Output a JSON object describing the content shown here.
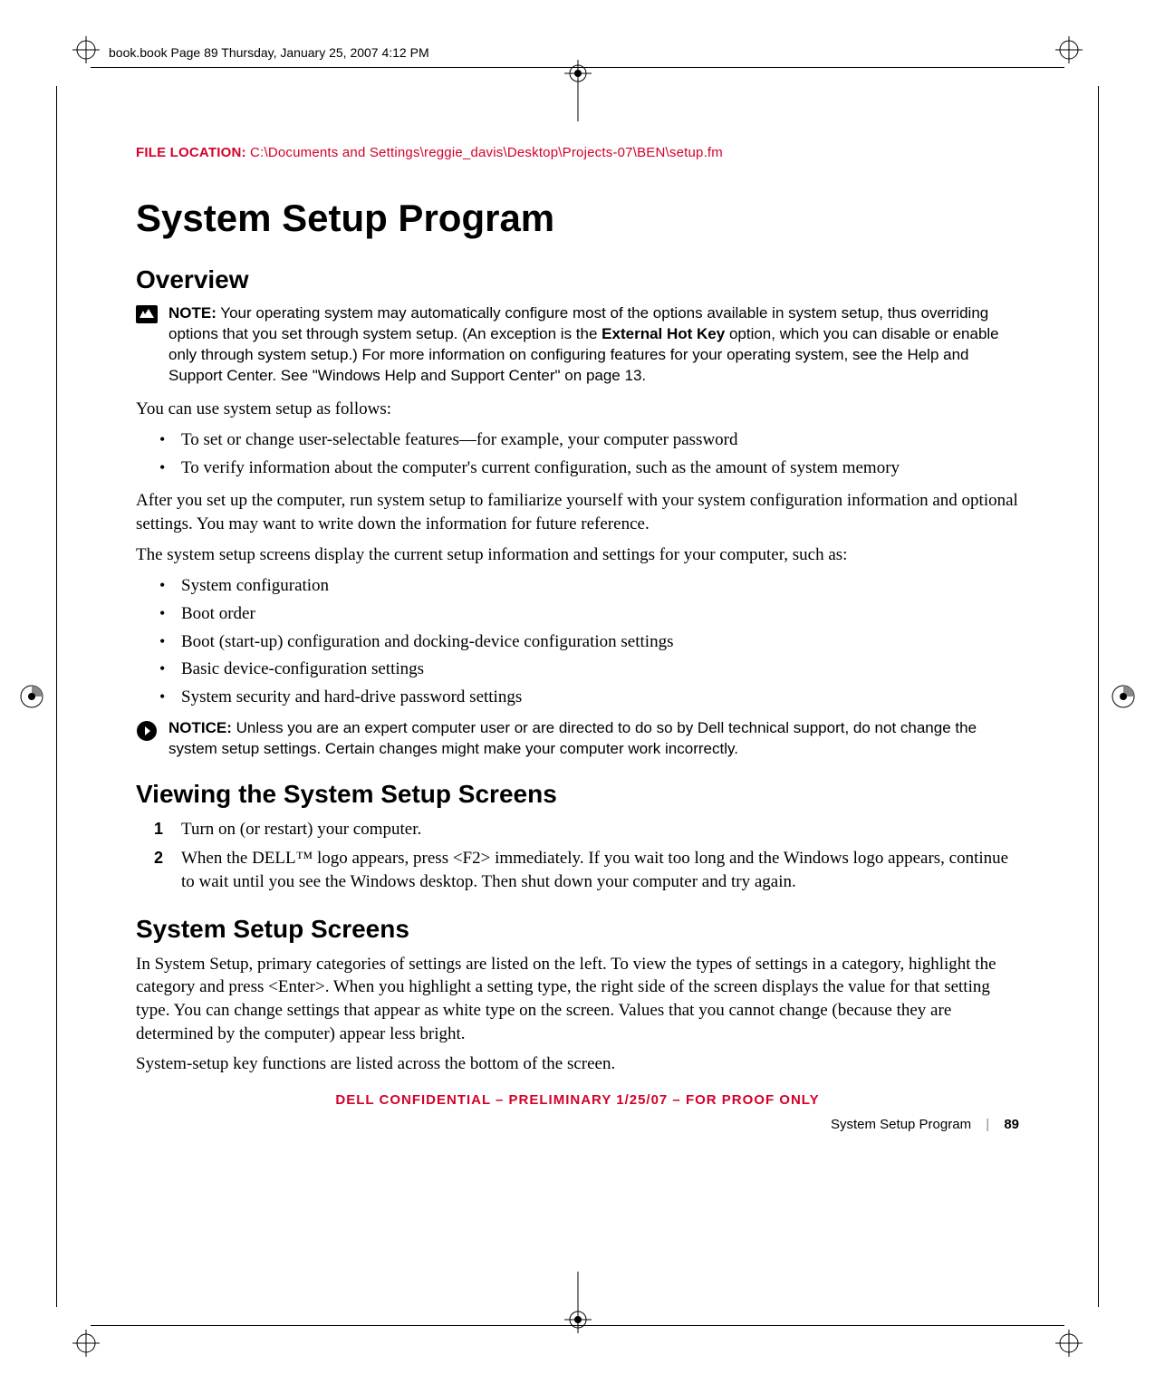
{
  "meta": {
    "header_line": "book.book  Page 89  Thursday, January 25, 2007  4:12 PM"
  },
  "file_location": {
    "label": "FILE LOCATION:",
    "path": "  C:\\Documents and Settings\\reggie_davis\\Desktop\\Projects-07\\BEN\\setup.fm"
  },
  "title": "System Setup Program",
  "overview": {
    "heading": "Overview",
    "note_label": "NOTE:",
    "note_text_a": " Your operating system may automatically configure most of the options available in system setup, thus overriding options that you set through system setup. (An exception is the ",
    "note_bold": "External Hot Key",
    "note_text_b": " option, which you can disable or enable only through system setup.) For more information on configuring features for your operating system, see the Help and Support Center. See \"Windows Help and Support Center\" on page 13.",
    "p1": "You can use system setup as follows:",
    "bullets1": [
      "To set or change user-selectable features—for example, your computer password",
      "To verify information about the computer's current configuration, such as the amount of system memory"
    ],
    "p2": "After you set up the computer, run system setup to familiarize yourself with your system configuration information and optional settings. You may want to write down the information for future reference.",
    "p3": "The system setup screens display the current setup information and settings for your computer, such as:",
    "bullets2": [
      "System configuration",
      "Boot order",
      "Boot (start-up) configuration and docking-device configuration settings",
      "Basic device-configuration settings",
      "System security and hard-drive password settings"
    ],
    "notice_label": "NOTICE:",
    "notice_text": " Unless you are an expert computer user or are directed to do so by Dell technical support, do not change the system setup settings. Certain changes might make your computer work incorrectly."
  },
  "viewing": {
    "heading": "Viewing the System Setup Screens",
    "steps": [
      "Turn on (or restart) your computer.",
      "When the DELL™ logo appears, press <F2> immediately. If you wait too long and the Windows logo appears, continue to wait until you see the Windows desktop. Then shut down your computer and try again."
    ]
  },
  "screens": {
    "heading": "System Setup Screens",
    "p1": "In System Setup, primary categories of settings are listed on the left. To view the types of settings in a category, highlight the category and press <Enter>. When you highlight a setting type, the right side of the screen displays the value for that setting type. You can change settings that appear as white type on the screen. Values that you cannot change (because they are determined by the computer) appear less bright.",
    "p2": "System-setup key functions are listed across the bottom of the screen."
  },
  "confidential": "DELL CONFIDENTIAL – PRELIMINARY 1/25/07 – FOR PROOF ONLY",
  "footer": {
    "section": "System Setup Program",
    "page": "89"
  }
}
